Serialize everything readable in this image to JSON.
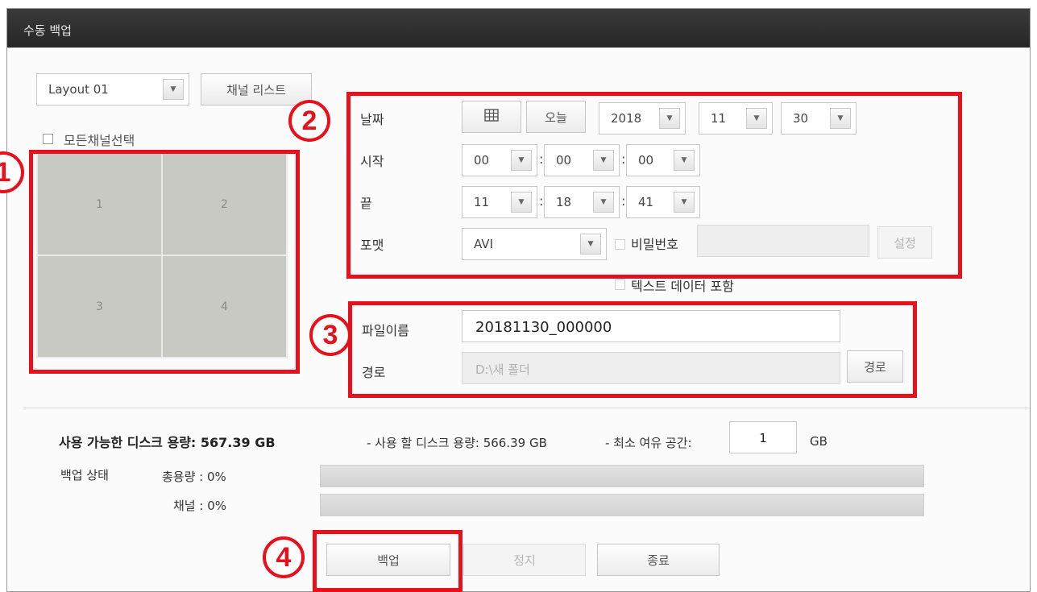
{
  "window": {
    "title": "수동 백업"
  },
  "left": {
    "layout_select": "Layout 01",
    "channel_list_button": "채널 리스트",
    "select_all_label": "모든채널선택",
    "channels": [
      "1",
      "2",
      "3",
      "4"
    ]
  },
  "datetime": {
    "date_label": "날짜",
    "today_button": "오늘",
    "year": "2018",
    "month": "11",
    "day": "30",
    "start_label": "시작",
    "start_hour": "00",
    "start_min": "00",
    "start_sec": "00",
    "end_label": "끝",
    "end_hour": "11",
    "end_min": "18",
    "end_sec": "41",
    "format_label": "포맷",
    "format_value": "AVI",
    "password_label": "비밀번호",
    "set_button": "설정",
    "text_data_label": "텍스트 데이터 포함"
  },
  "file": {
    "name_label": "파일이름",
    "name_value": "20181130_000000",
    "path_label": "경로",
    "path_value": "D:\\새 폴더",
    "path_button": "경로"
  },
  "disk": {
    "available": "사용 가능한 디스크 용량: 567.39 GB",
    "to_use": "- 사용 할 디스크 용량: 566.39 GB",
    "min_free_label": "- 최소 여유 공간:",
    "min_free_value": "1",
    "min_free_unit": "GB"
  },
  "status": {
    "label": "백업 상태",
    "total_label": "총용량 : 0%",
    "channel_label": "채널 : 0%",
    "total_progress": 0,
    "channel_progress": 0
  },
  "actions": {
    "backup": "백업",
    "stop": "정지",
    "close": "종료"
  },
  "annotations": [
    "1",
    "2",
    "3",
    "4"
  ],
  "colors": {
    "highlight": "#e8101a",
    "titlebar": "#2e2e2e"
  }
}
